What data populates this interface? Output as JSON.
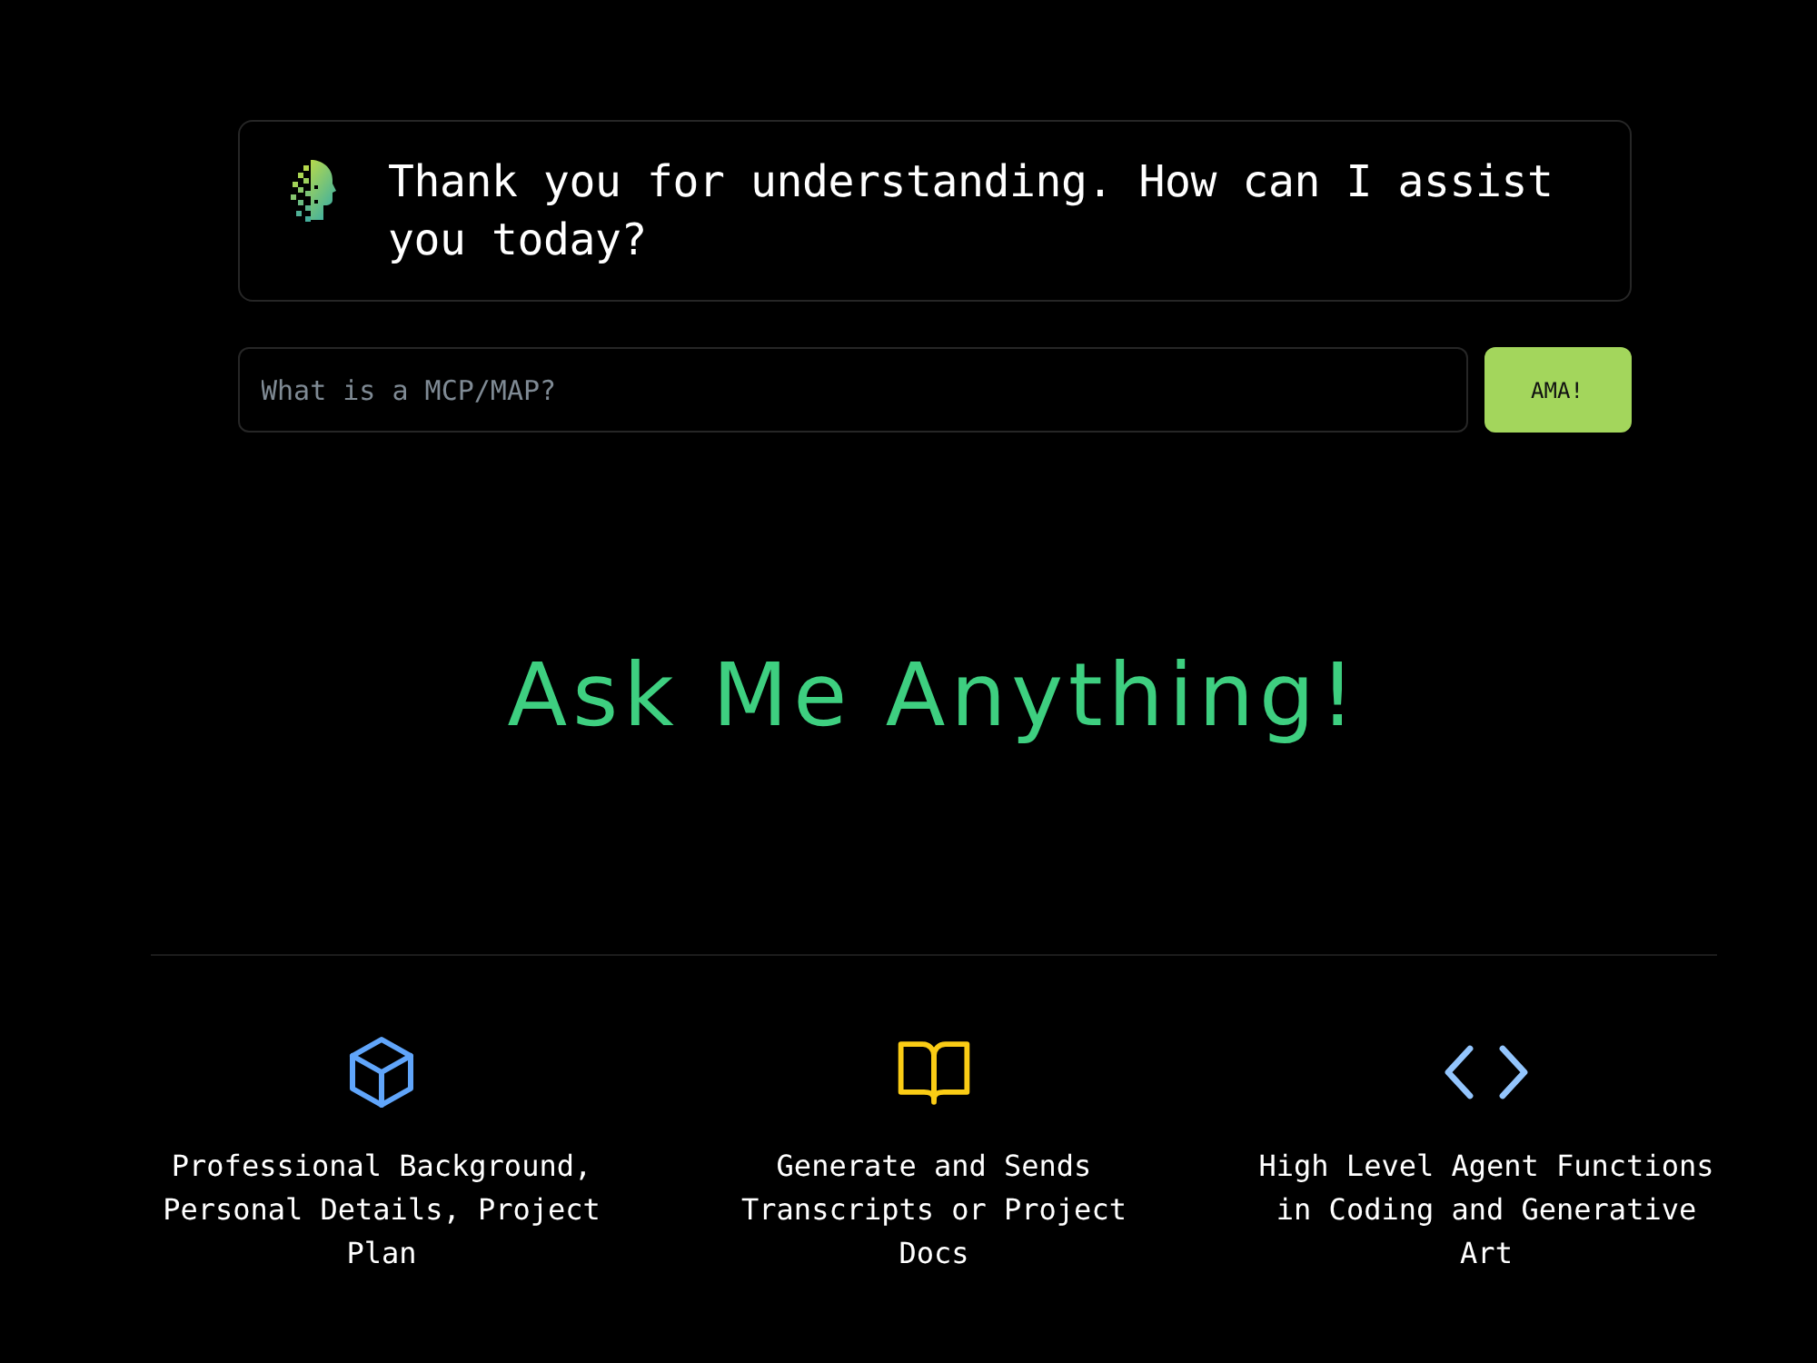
{
  "chat": {
    "message": "Thank you for understanding. How can I assist you today?"
  },
  "ask": {
    "placeholder": "What is a MCP/MAP?",
    "button": "AMA!"
  },
  "hero": {
    "title": "Ask Me Anything!"
  },
  "features": [
    {
      "text": "Professional Background, Personal Details, Project Plan",
      "color": "#60a5fa"
    },
    {
      "text": "Generate and Sends Transcripts or Project Docs",
      "color": "#facc15"
    },
    {
      "text": "High Level Agent Functions in Coding and Generative Art",
      "color": "#93c5fd"
    }
  ]
}
